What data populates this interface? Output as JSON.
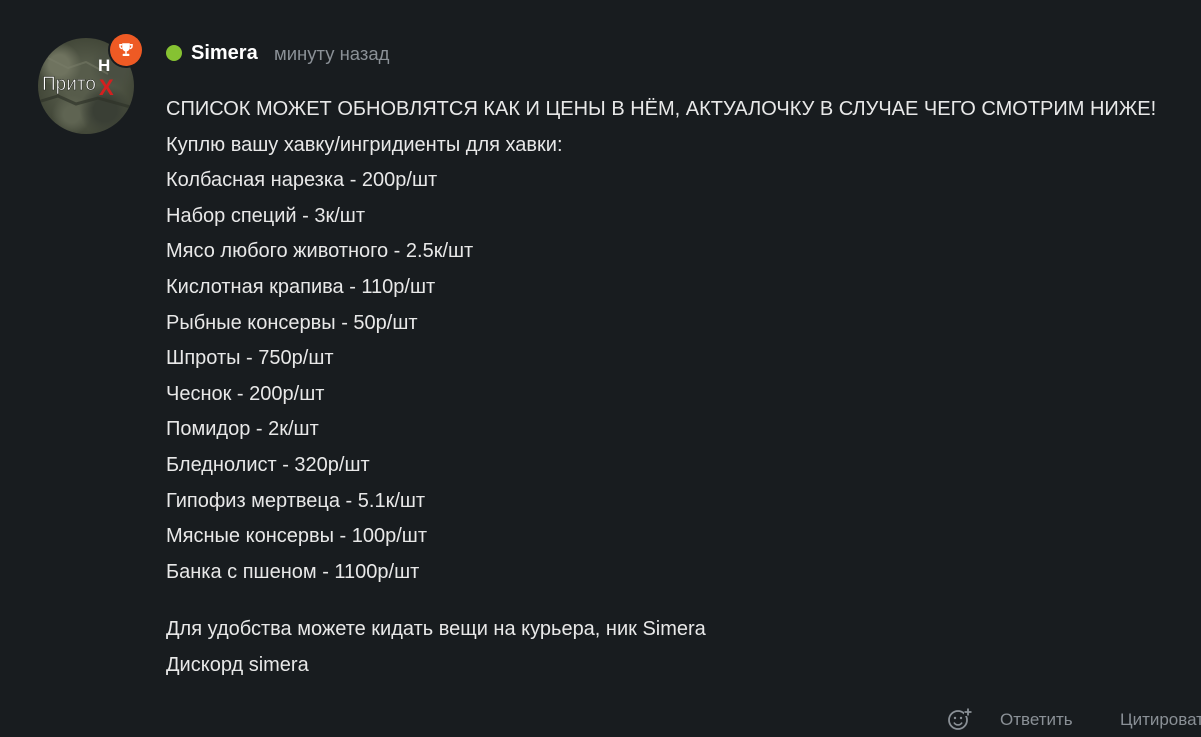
{
  "colors": {
    "background": "#181c1f",
    "text": "#e8e8e8",
    "muted": "#8a9096",
    "online": "#86c232",
    "badge": "#ee5a24",
    "logo_red": "#d41f1f"
  },
  "post": {
    "author": {
      "name": "Simera",
      "online": true,
      "avatar": {
        "logo_text": "Прито",
        "logo_mark_top": "Н",
        "logo_mark": "Х"
      },
      "badge_icon": "trophy-icon"
    },
    "time": "минуту назад",
    "body": {
      "lines": [
        "СПИСОК МОЖЕТ ОБНОВЛЯТСЯ КАК И ЦЕНЫ В НЁМ, АКТУАЛОЧКУ В СЛУЧАЕ ЧЕГО СМОТРИМ НИЖЕ!",
        "Куплю вашу хавку/ингридиенты для хавки:",
        "Колбасная нарезка - 200р/шт",
        "Набор специй - 3к/шт",
        "Мясо любого животного - 2.5к/шт",
        "Кислотная крапива - 110р/шт",
        "Рыбные консервы - 50р/шт",
        "Шпроты - 750р/шт",
        "Чеснок - 200р/шт",
        "Помидор - 2к/шт",
        "Бледнолист - 320р/шт",
        "Гипофиз мертвеца - 5.1к/шт",
        "Мясные консервы - 100р/шт",
        "Банка с пшеном - 1100р/шт"
      ],
      "footer_lines": [
        "Для удобства можете кидать вещи на курьера, ник Simera",
        "Дискорд simera"
      ]
    }
  },
  "actions": {
    "reaction_icon": "add-reaction-icon",
    "reply": "Ответить",
    "quote": "Цитировать"
  }
}
